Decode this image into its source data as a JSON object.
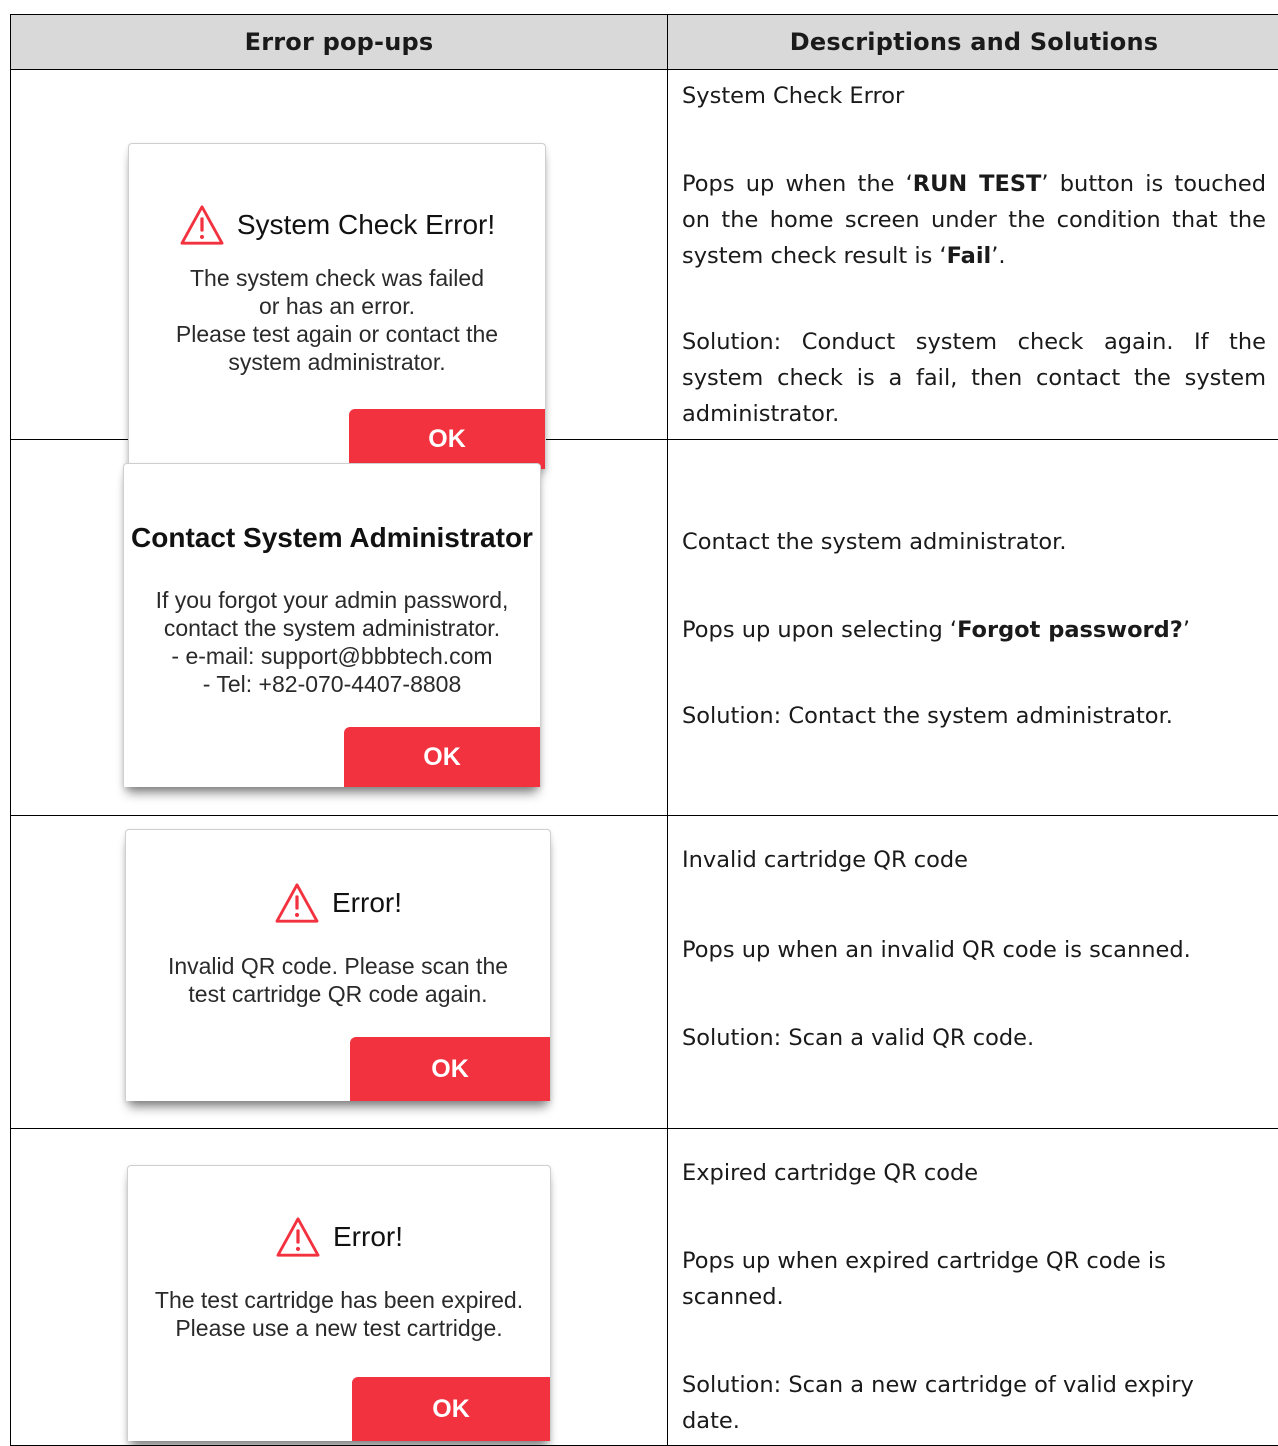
{
  "table": {
    "header_left": "Error pop-ups",
    "header_right": "Descriptions and Solutions"
  },
  "rows": [
    {
      "popup": {
        "title": "System Check Error!",
        "has_warning_icon": true,
        "body": [
          "The system check was failed",
          "or has an error.",
          "Please test again or contact the",
          "system administrator."
        ],
        "ok_label": "OK"
      },
      "desc": {
        "title": "System Check Error",
        "line1_a": "Pops up when the ‘",
        "line1_b": "RUN TEST",
        "line1_c": "’ button is touched on the home screen under the condition that the system check result is ‘",
        "line1_d": "Fail",
        "line1_e": "’.",
        "solution": "Solution: Conduct system check again. If the system check is a fail, then contact the system administrator."
      }
    },
    {
      "popup": {
        "title": "Contact System Administrator",
        "has_warning_icon": false,
        "body": [
          "If you forgot your admin password,",
          "contact the system administrator.",
          "- e-mail: support@bbbtech.com",
          "- Tel: +82-070-4407-8808"
        ],
        "ok_label": "OK"
      },
      "desc": {
        "title": "Contact the system administrator.",
        "line1_a": "Pops up upon selecting ‘",
        "line1_b": "Forgot password?",
        "line1_c": "’",
        "solution": "Solution: Contact the system administrator."
      }
    },
    {
      "popup": {
        "title": "Error!",
        "has_warning_icon": true,
        "body": [
          "Invalid QR code. Please scan the",
          "test cartridge QR code again."
        ],
        "ok_label": "OK"
      },
      "desc": {
        "title": "Invalid cartridge QR code",
        "line1": "Pops up when an invalid QR code is scanned.",
        "solution": "Solution: Scan a valid QR code."
      }
    },
    {
      "popup": {
        "title": "Error!",
        "has_warning_icon": true,
        "body": [
          "The test cartridge has been expired.",
          "Please use a new test cartridge."
        ],
        "ok_label": "OK"
      },
      "desc": {
        "title": "Expired cartridge QR code",
        "line1": "Pops up when expired cartridge QR code is scanned.",
        "solution": "Solution:  Scan a new cartridge of  valid expiry date."
      }
    }
  ],
  "colors": {
    "accent_red": "#f3323f",
    "header_gray": "#d9d9d9"
  },
  "icons": {
    "warning": "warning-triangle-icon"
  }
}
